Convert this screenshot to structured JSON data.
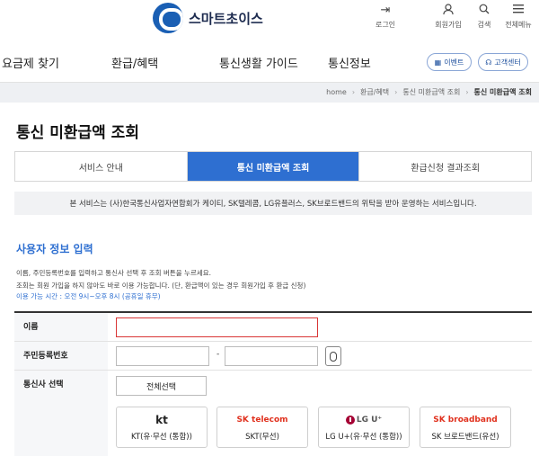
{
  "header": {
    "logo_text": "스마트초이스",
    "utils": [
      {
        "icon": "login-icon",
        "label": "로그인"
      },
      {
        "icon": "user-icon",
        "label": "회원가입"
      },
      {
        "icon": "search-icon",
        "label": "검색"
      },
      {
        "icon": "menu-icon",
        "label": "전체메뉴"
      }
    ]
  },
  "gnb": {
    "items": [
      "요금제 찾기",
      "환급/혜택",
      "통신생활 가이드",
      "통신정보"
    ],
    "event_label": "이벤트",
    "support_label": "고객센터"
  },
  "breadcrumb": {
    "items": [
      "home",
      "환급/혜택",
      "통신 미환급액 조회",
      "통신 미환급액 조회"
    ]
  },
  "page_title": "통신 미환급액 조회",
  "tabs": [
    {
      "label": "서비스 안내",
      "active": false
    },
    {
      "label": "통신 미환급액 조회",
      "active": true
    },
    {
      "label": "환급신청 결과조회",
      "active": false
    }
  ],
  "notice": "본 서비스는 (사)한국통신사업자연합회가 케이티, SK텔레콤, LG유플러스, SK브로드밴드의 위탁을 받아 운영하는 서비스입니다.",
  "section_title": "사용자 정보 입력",
  "descriptions": [
    "이름, 주민등록번호를 입력하고 통신사 선택 후 조회 버튼을 누르세요.",
    "조회는 회원 가입을 하지 않아도 바로 이용 가능합니다. (단, 환급액이 있는 경우 회원가입 후 환급 신청)"
  ],
  "hours": "이용 가능 시간 : 오전 9시~오후 8시 (공휴일 휴무)",
  "form": {
    "name_label": "이름",
    "name_value": "",
    "rrn_label": "주민등록번호",
    "rrn_front": "",
    "rrn_dash": "-",
    "rrn_back": "",
    "carrier_label": "통신사 선택",
    "select_all": "전체선택",
    "carriers": [
      {
        "logo": "kt",
        "name": "KT(유·무선 (통합))"
      },
      {
        "logo": "SK telecom",
        "name": "SKT(무선)"
      },
      {
        "logo": "LG U⁺",
        "name": "LG U+(유·무선 (통합))"
      },
      {
        "logo": "SK broadband",
        "name": "SK 브로드밴드(유선)"
      }
    ]
  },
  "colors": {
    "brand_blue": "#2e6fd1",
    "error_red": "#d93636",
    "sk_red": "#e0311e",
    "lg_magenta": "#a50034"
  }
}
